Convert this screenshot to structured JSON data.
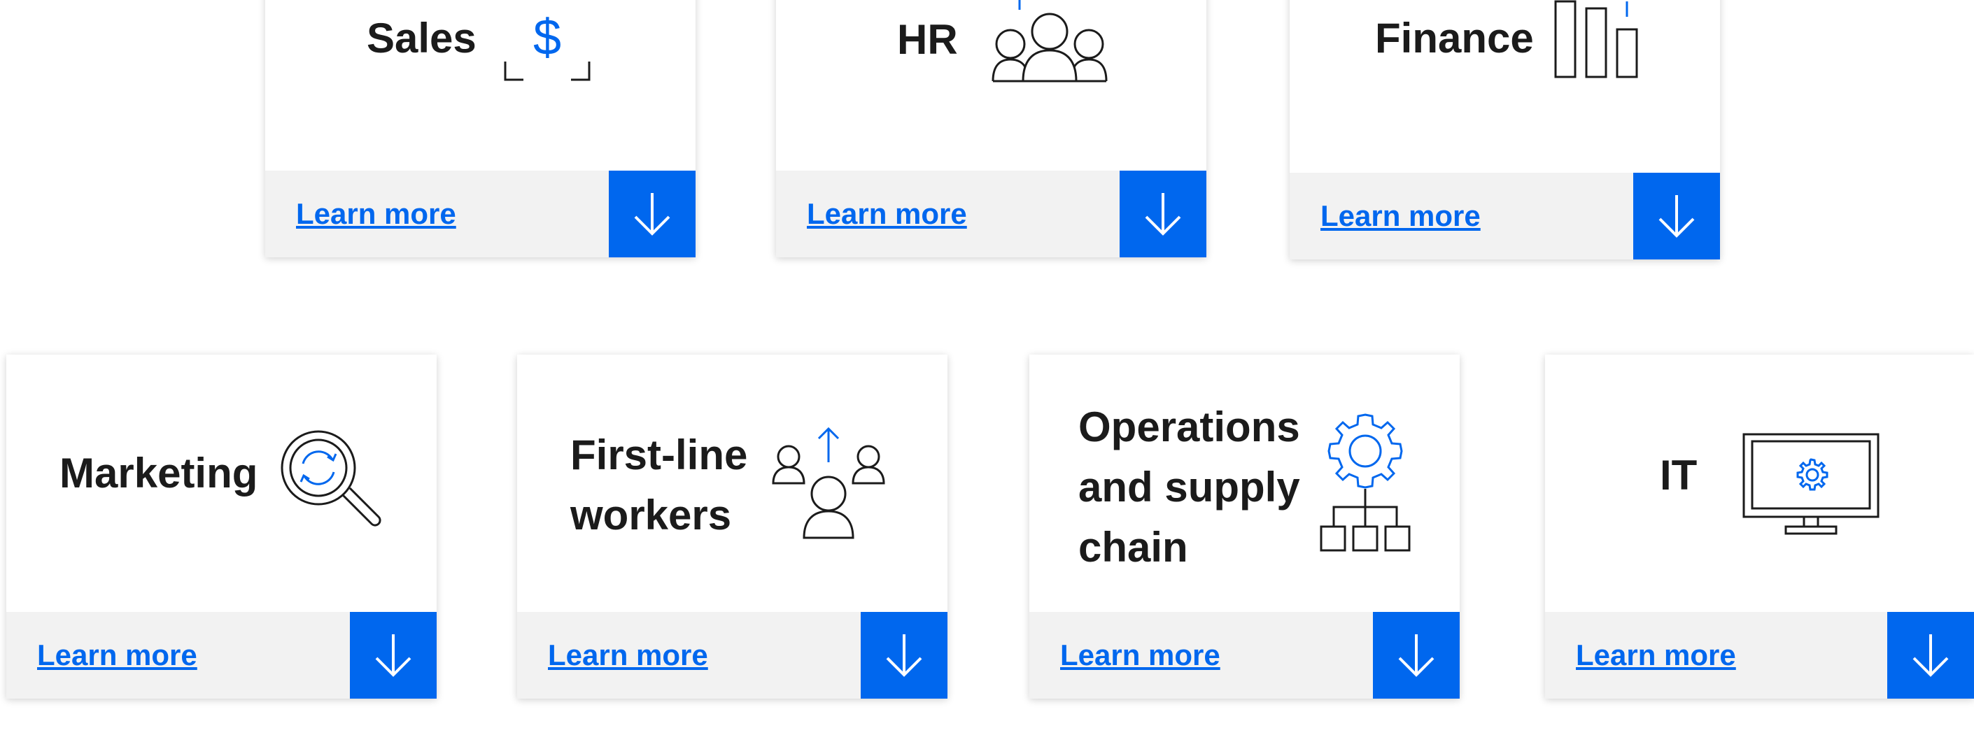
{
  "colors": {
    "accent": "#0067ee",
    "footer_bg": "#f2f2f2",
    "text": "#1b1b1b",
    "icon_stroke": "#1b1b1b"
  },
  "cards": [
    {
      "id": "sales",
      "title_lines": [
        "Sales"
      ],
      "icon": "dollar-frame-icon",
      "link": "Learn more",
      "button_icon": "arrow-down-icon"
    },
    {
      "id": "hr",
      "title_lines": [
        "HR"
      ],
      "icon": "people-group-icon",
      "link": "Learn more",
      "button_icon": "arrow-down-icon"
    },
    {
      "id": "finance",
      "title_lines": [
        "Finance"
      ],
      "icon": "bar-chart-icon",
      "link": "Learn more",
      "button_icon": "arrow-down-icon"
    },
    {
      "id": "marketing",
      "title_lines": [
        "Marketing"
      ],
      "icon": "magnifier-refresh-icon",
      "link": "Learn more",
      "button_icon": "arrow-down-icon"
    },
    {
      "id": "first-line-workers",
      "title_lines": [
        "First-line",
        "workers"
      ],
      "icon": "people-upload-icon",
      "link": "Learn more",
      "button_icon": "arrow-down-icon"
    },
    {
      "id": "operations",
      "title_lines": [
        "Operations",
        "and supply",
        "chain"
      ],
      "icon": "gear-hierarchy-icon",
      "link": "Learn more",
      "button_icon": "arrow-down-icon"
    },
    {
      "id": "it",
      "title_lines": [
        "IT"
      ],
      "icon": "monitor-gear-icon",
      "link": "Learn more",
      "button_icon": "arrow-down-icon"
    }
  ]
}
